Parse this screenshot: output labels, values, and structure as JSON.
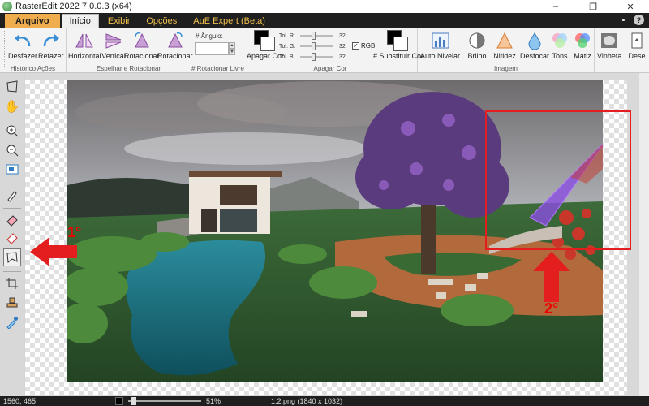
{
  "window": {
    "title": "RasterEdit 2022 7.0.0.3 (x64)",
    "minimize": "–",
    "restore": "❐",
    "close": "✕"
  },
  "menu": {
    "tabs": [
      "Arquivo",
      "Início",
      "Exibir",
      "Opções",
      "AuE Expert (Beta)"
    ],
    "active": "Início"
  },
  "ribbon": {
    "history": {
      "label": "Histórico Ações",
      "undo": "Desfazer",
      "redo": "Refazer"
    },
    "mirror": {
      "label": "Espelhar e Rotacionar",
      "horizontal": "Horizontal",
      "vertical": "Vertical",
      "rotate1": "Rotacionar",
      "rotate2": "Rotacionar"
    },
    "free_rotate": {
      "label": "# Rotacionar Livre",
      "angle_label": "# Ângulo:",
      "angle_value": ""
    },
    "clear_color": {
      "label": "Apagar Cor",
      "clear": "Apagar Cor",
      "replace": "# Substituir Cor",
      "rgb": "RGB",
      "tol_r": "Tol. R:",
      "tol_g": "Tol. G:",
      "tol_b": "Tol. B:",
      "val_r": "32",
      "val_g": "32",
      "val_b": "32"
    },
    "image": {
      "label": "Imagem",
      "auto": "Auto Nivelar",
      "brightness": "Brilho",
      "sharpness": "Nitidez",
      "blur": "Desfocar",
      "tones": "Tons",
      "hue": "Matiz",
      "vignette": "Vinheta",
      "more": "Dese"
    }
  },
  "annotations": {
    "step1": "1°",
    "step2": "2°"
  },
  "status": {
    "coords": "1560, 465",
    "zoom": "51%",
    "file": "1.2.png (1840 x 1032)"
  },
  "colors": {
    "accent": "#f0ad4e",
    "annotation": "#e41e1e",
    "selection": "#8a4ee0"
  }
}
